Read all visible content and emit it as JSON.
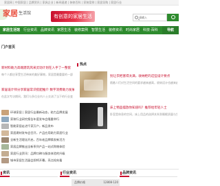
{
  "topbar": {
    "crumbs": "家居网 | 中国家居 | 品牌资讯 | 家具企业 | 新闻速递 | 装修百科 | 家装案例 | 家居导购 | 家居行业"
  },
  "header": {
    "logo_text": "家居",
    "logo_sub": "生活馆",
    "slogan": "有创意的家居生活",
    "search_placeholder": "请输入",
    "colors": {
      "brand_green": "#2e8b2e",
      "accent_red": "#c8102e"
    }
  },
  "nav": {
    "items": [
      "家居生活馆",
      "行业资讯",
      "品牌资讯",
      "家居生活",
      "装修案例",
      "智慧生活",
      "装修资讯",
      "时尚家居",
      "科技·百科"
    ],
    "right_label": "导航"
  },
  "left": {
    "section_title": "门户首页",
    "feature_1_title": "新材料助力高端建筑风采灵动计划在入手了一整套",
    "feature_1_desc": "每个人都应享受生活带来的美好事物，家居是最重要的一部分，把握住当前形式",
    "feature_2_title": "家居设计师分享家居常识搭配推介 数字消费助力发展新格局",
    "feature_2_desc": "在此次专访期间，我们与多位业内人士交流了当下的行业变化...",
    "list": [
      "环球家居 | 家居行业最新动态，助力品牌发展",
      "家装行业研究报告年度发布会隆重举行",
      "智能家居走进千家万户，新品发布",
      "家居建材发布会召开，产品应用助力家居行业",
      "全新生活理念开启，百年老品牌焕发新活力",
      "家居品牌推出全新系列产品一站式购物体验",
      "家居行业资讯：品牌口碑与服务体验的升级",
      "城市家居生活展会即将开幕，亮点抢先看"
    ]
  },
  "right": {
    "section_title": "热点",
    "hot_1_title": "别让衣柜塞得太满，收纳柜的这些设计要点",
    "hot_1_desc": "随着人们对生活空间的要求越来越高，收纳设计也越来越受欢迎",
    "hot_2_title": "床上物品摆放你知道吗？推荐给年轻人士",
    "hot_2_desc": "卧室是休息的空间，床上用品的选择关系到睡眠质量与生活品质"
  },
  "bottom": {
    "col1_title": "资讯",
    "col2_title": "行业资讯",
    "col3_title": "品牌资讯",
    "thumb_label": "品牌价格",
    "thumb_num": "12808·120"
  }
}
